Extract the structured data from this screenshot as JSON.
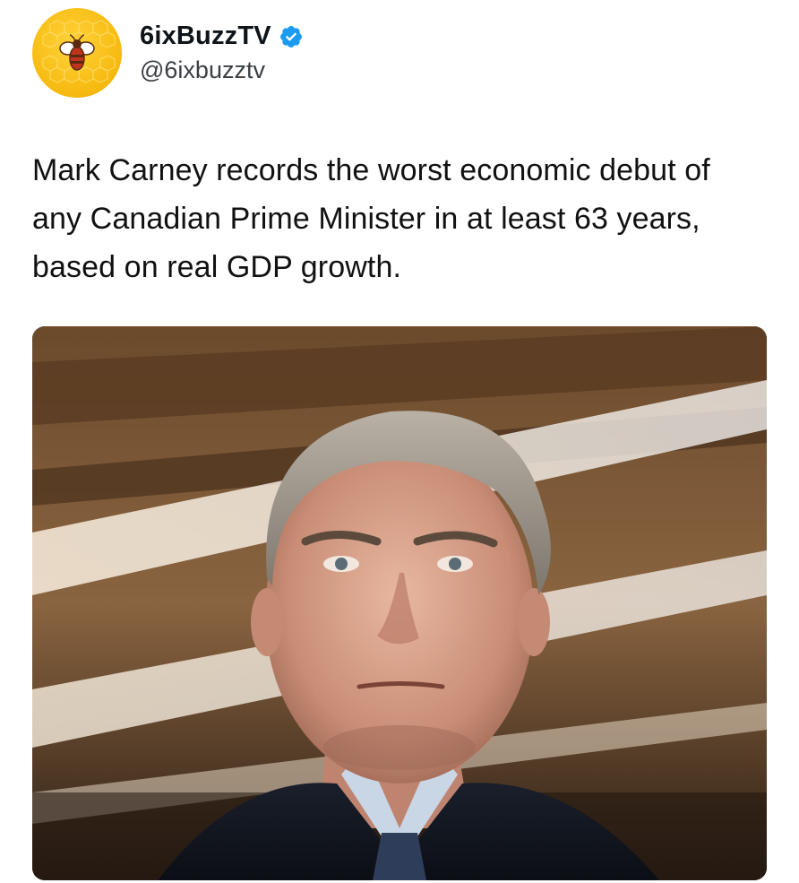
{
  "tweet": {
    "author": {
      "display_name": "6ixBuzzTV",
      "handle": "@6ixbuzztv",
      "verified": true,
      "avatar_icon": "bee-logo-icon",
      "verified_icon": "verified-badge-icon"
    },
    "text": "Mark Carney records the worst economic debut of any Canadian Prime Minister in at least 63 years, based on real GDP growth.",
    "media": {
      "type": "photo",
      "icon": "portrait-photo"
    }
  },
  "colors": {
    "verified_blue": "#1d9bf0",
    "avatar_yellow": "#f6b90f",
    "text": "#0f1419",
    "handle": "#3a3f44"
  }
}
